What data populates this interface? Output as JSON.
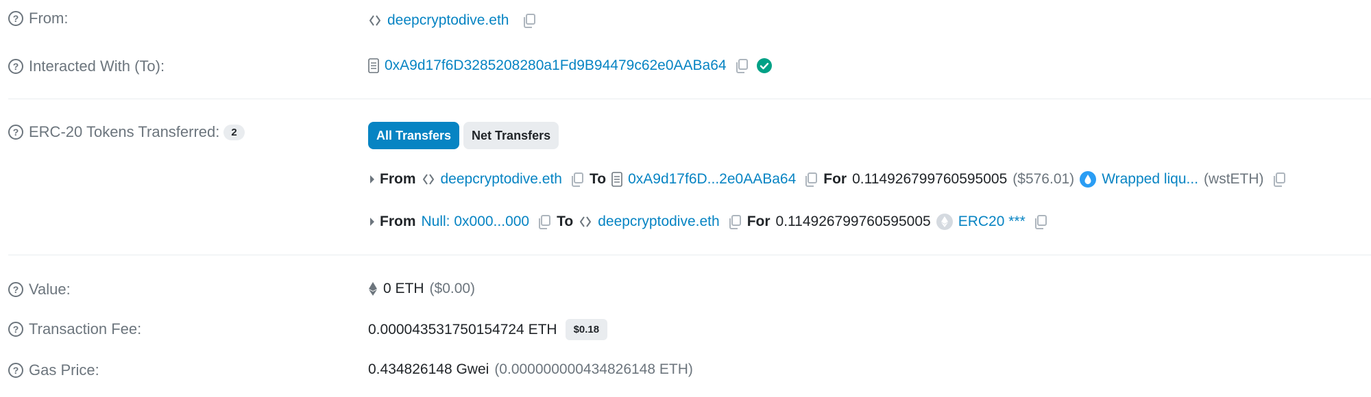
{
  "from": {
    "label": "From:",
    "name": "deepcryptodive.eth"
  },
  "interacted": {
    "label": "Interacted With (To):",
    "address": "0xA9d17f6D3285208280a1Fd9B94479c62e0AABa64"
  },
  "erc20": {
    "label": "ERC-20 Tokens Transferred:",
    "count": "2",
    "buttons": {
      "all": "All Transfers",
      "net": "Net Transfers"
    },
    "transfers": [
      {
        "from_word": "From",
        "from_name": "deepcryptodive.eth",
        "to_word": "To",
        "to_name": "0xA9d17f6D...2e0AABa64",
        "for_word": "For",
        "amount": "0.114926799760595005",
        "usd": "($576.01)",
        "token_name": "Wrapped liqu...",
        "token_symbol": "(wstETH)"
      },
      {
        "from_word": "From",
        "from_name": "Null: 0x000...000",
        "to_word": "To",
        "to_name": "deepcryptodive.eth",
        "for_word": "For",
        "amount": "0.114926799760595005",
        "token_name": "ERC20 ***"
      }
    ]
  },
  "value": {
    "label": "Value:",
    "amount": "0 ETH",
    "usd": "($0.00)"
  },
  "fee": {
    "label": "Transaction Fee:",
    "amount": "0.000043531750154724 ETH",
    "usd": "$0.18"
  },
  "gas": {
    "label": "Gas Price:",
    "amount": "0.434826148 Gwei",
    "eth": "(0.000000000434826148 ETH)"
  },
  "icons": {
    "help": "question-circle-icon",
    "ens": "ens-diamond-icon",
    "contract": "file-contract-icon",
    "copy": "copy-icon",
    "verified": "check-circle-icon",
    "token_wsteth": "wsteth-drop-icon",
    "token_generic": "eth-diamond-icon",
    "expand": "caret-right-icon"
  },
  "colors": {
    "link": "#0784c3",
    "muted": "#6c757d",
    "verified": "#00a186",
    "badge_bg": "#e9ecef",
    "primary": "#0784c3"
  }
}
